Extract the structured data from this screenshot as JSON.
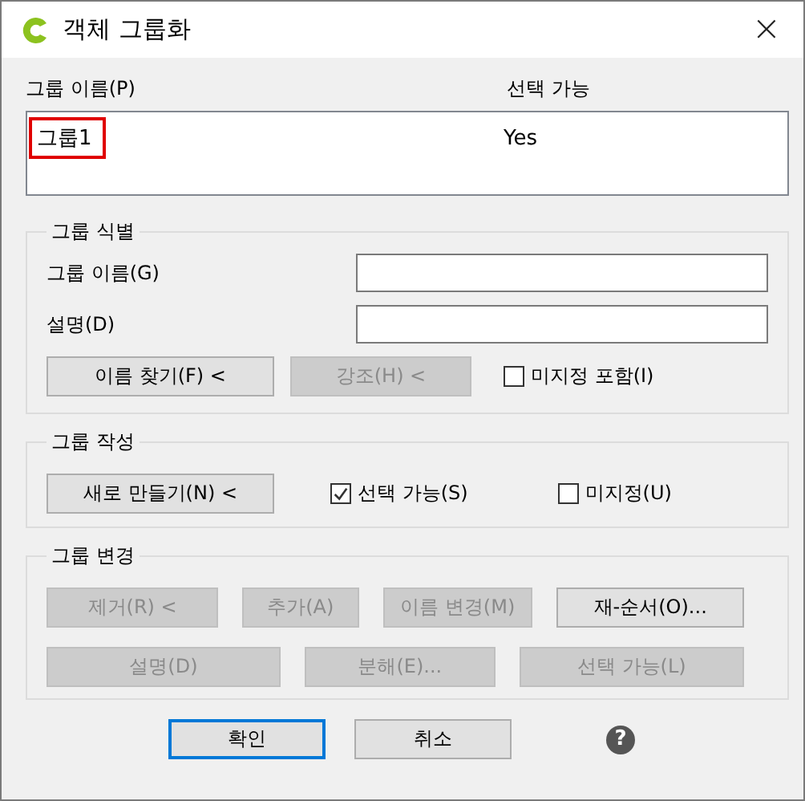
{
  "window": {
    "title": "객체 그룹화",
    "close": "×"
  },
  "group_list": {
    "columns": [
      "그룹 이름(P)",
      "선택 가능"
    ],
    "rows": [
      {
        "name": "그룹1",
        "selectable": "Yes",
        "highlighted": true
      }
    ]
  },
  "identify": {
    "title": "그룹 식별",
    "fields": [
      {
        "label": "그룹 이름(G)"
      },
      {
        "label": "설명(D)"
      }
    ],
    "buttons": [
      {
        "label": "이름 찾기(F) <",
        "disabled": false
      },
      {
        "label": "강조(H) <",
        "disabled": true
      }
    ],
    "checkbox": {
      "label": "미지정 포함(I)",
      "checked": false
    }
  },
  "create": {
    "title": "그룹 작성",
    "button": {
      "label": "새로 만들기(N) <",
      "disabled": false
    },
    "checkboxes": [
      {
        "label": "선택 가능(S)",
        "checked": true
      },
      {
        "label": "미지정(U)",
        "checked": false
      }
    ]
  },
  "modify": {
    "title": "그룹 변경",
    "upper_buttons": [
      {
        "label": "제거(R) <",
        "disabled": true
      },
      {
        "label": "추가(A)",
        "disabled": true
      },
      {
        "label": "이름 변경(M)",
        "disabled": true
      },
      {
        "label": "재-순서(O)...",
        "disabled": false
      }
    ],
    "lower_buttons": [
      {
        "label": "설명(D)",
        "disabled": true
      },
      {
        "label": "분해(E)...",
        "disabled": true
      },
      {
        "label": "선택 가능(L)",
        "disabled": true
      }
    ]
  },
  "footer": {
    "buttons": [
      {
        "label": "확인",
        "focused": true
      },
      {
        "label": "취소",
        "focused": false
      }
    ],
    "help": "?"
  }
}
